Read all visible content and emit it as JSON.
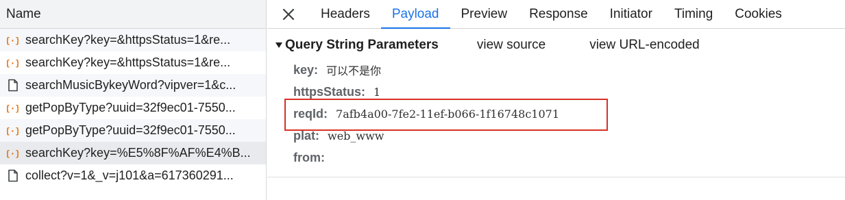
{
  "left_header": {
    "title": "Name"
  },
  "requests": [
    {
      "icon": "xhr-icon",
      "name": "searchKey?key=&httpsStatus=1&re...",
      "alt": true
    },
    {
      "icon": "xhr-icon",
      "name": "searchKey?key=&httpsStatus=1&re...",
      "alt": false
    },
    {
      "icon": "document-icon",
      "name": "searchMusicBykeyWord?vipver=1&c...",
      "alt": true
    },
    {
      "icon": "xhr-icon",
      "name": "getPopByType?uuid=32f9ec01-7550...",
      "alt": false
    },
    {
      "icon": "xhr-icon",
      "name": "getPopByType?uuid=32f9ec01-7550...",
      "alt": true
    },
    {
      "icon": "xhr-icon",
      "name": "searchKey?key=%E5%8F%AF%E4%B...",
      "selected": true
    },
    {
      "icon": "document-icon",
      "name": "collect?v=1&_v=j101&a=617360291...",
      "alt": false
    }
  ],
  "tabs": [
    "Headers",
    "Payload",
    "Preview",
    "Response",
    "Initiator",
    "Timing",
    "Cookies"
  ],
  "active_tab": "Payload",
  "payload": {
    "section_title": "Query String Parameters",
    "view_source": "view source",
    "view_url_encoded": "view URL-encoded",
    "params": [
      {
        "key": "key:",
        "value": "可以不是你"
      },
      {
        "key": "httpsStatus:",
        "value": "1"
      },
      {
        "key": "reqId:",
        "value": "7afb4a00-7fe2-11ef-b066-1f16748c1071"
      },
      {
        "key": "plat:",
        "value": "web_www"
      },
      {
        "key": "from:",
        "value": ""
      }
    ]
  },
  "colors": {
    "accent": "#1a73e8",
    "xhr_icon": "#e8710a",
    "highlight": "#d93025"
  }
}
